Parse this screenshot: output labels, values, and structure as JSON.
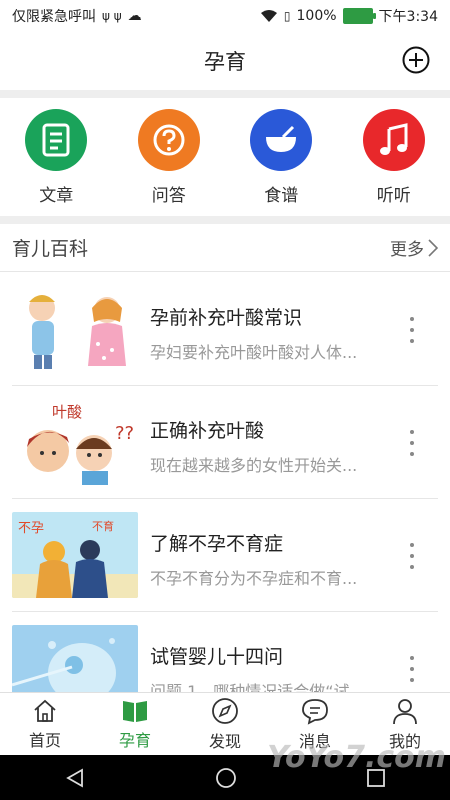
{
  "status": {
    "left_text": "仅限紧急呼叫",
    "battery": "100%",
    "time": "下午3:34"
  },
  "header": {
    "title": "孕育"
  },
  "shortcuts": [
    {
      "label": "文章",
      "color": "#1aa35a",
      "icon": "document-icon"
    },
    {
      "label": "问答",
      "color": "#ef7a22",
      "icon": "question-icon"
    },
    {
      "label": "食谱",
      "color": "#2a59d8",
      "icon": "bowl-icon"
    },
    {
      "label": "听听",
      "color": "#e8282b",
      "icon": "music-note-icon"
    }
  ],
  "section": {
    "title": "育儿百科",
    "more": "更多"
  },
  "articles": [
    {
      "title": "孕前补充叶酸常识",
      "desc": "孕妇要补充叶酸叶酸对人体..."
    },
    {
      "title": "正确补充叶酸",
      "desc": "现在越来越多的女性开始关...",
      "thumb_text": "叶酸"
    },
    {
      "title": "了解不孕不育症",
      "desc": "不孕不育分为不孕症和不育...",
      "thumb_text_1": "不孕",
      "thumb_text_2": "不育"
    },
    {
      "title": "试管婴儿十四问",
      "desc": "问题 1　哪种情况适合做“试..."
    }
  ],
  "tabs": [
    {
      "label": "首页",
      "icon": "home-icon"
    },
    {
      "label": "孕育",
      "icon": "book-icon"
    },
    {
      "label": "发现",
      "icon": "compass-icon"
    },
    {
      "label": "消息",
      "icon": "message-icon"
    },
    {
      "label": "我的",
      "icon": "person-icon"
    }
  ],
  "watermark": "YoYo7.com"
}
